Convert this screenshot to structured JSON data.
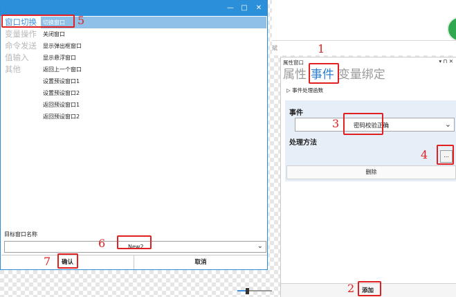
{
  "dialog": {
    "window_controls": [
      "—",
      "□",
      "✕"
    ],
    "categories": [
      {
        "label": "窗口切换",
        "active": true
      },
      {
        "label": "变量操作",
        "active": false
      },
      {
        "label": "命令发送",
        "active": false
      },
      {
        "label": "值输入",
        "active": false
      },
      {
        "label": "其他",
        "active": false
      }
    ],
    "actions": [
      {
        "label": "切换窗口",
        "selected": true
      },
      {
        "label": "关闭窗口",
        "selected": false
      },
      {
        "label": "显示弹出框窗口",
        "selected": false
      },
      {
        "label": "显示悬浮窗口",
        "selected": false
      },
      {
        "label": "返回上一个窗口",
        "selected": false
      },
      {
        "label": "设置预设窗口1",
        "selected": false
      },
      {
        "label": "设置预设窗口2",
        "selected": false
      },
      {
        "label": "返回预设窗口1",
        "selected": false
      },
      {
        "label": "返回预设窗口2",
        "selected": false
      }
    ],
    "target_label": "目标窗口名称",
    "target_value": "New2",
    "dropdown_arrow": "⌄",
    "ok_label": "确认",
    "cancel_label": "取消"
  },
  "background": {
    "text": "斌"
  },
  "props": {
    "title": "属性窗口",
    "controls": "▾ ⊓ ✕",
    "tabs": [
      {
        "label": "属性",
        "active": false
      },
      {
        "label": "事件",
        "active": true
      },
      {
        "label": "变量绑定",
        "active": false
      }
    ],
    "handler_section": "▷ 事件处理函数",
    "event_label": "事件",
    "event_value": "密码校验正确",
    "dropdown_arrow": "⌄",
    "handler_label": "处理方法",
    "browse_label": "...",
    "delete_label": "删除",
    "add_label": "添加"
  },
  "annotations": [
    "1",
    "2",
    "3",
    "4",
    "5",
    "6",
    "7"
  ],
  "colors": {
    "accent": "#2b90d9",
    "annotation_red": "#e02020",
    "tab_active": "#2b7fd3",
    "category_active": "#3a8ede",
    "selection": "#8fc1e8",
    "event_box_bg": "#e6eef8"
  }
}
